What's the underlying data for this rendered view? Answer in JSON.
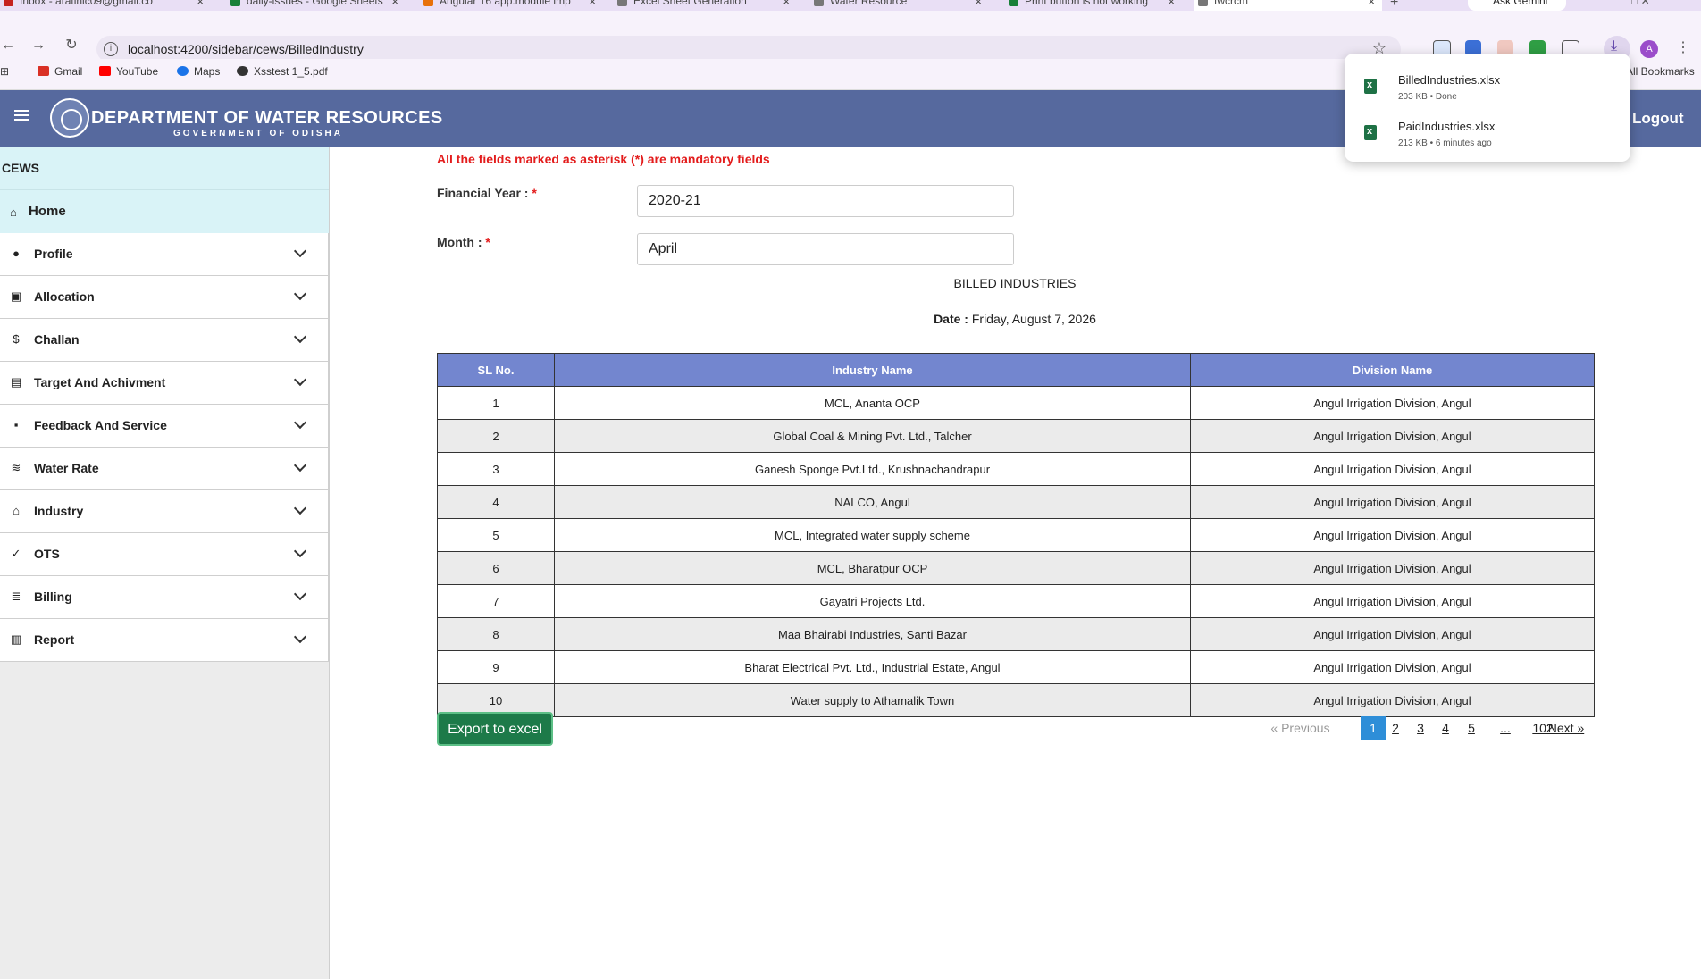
{
  "browser": {
    "tabs": [
      {
        "label": "Inbox - aratinic09@gmail.co",
        "icon_color": "#c5221f"
      },
      {
        "label": "daily-issues - Google Sheets",
        "icon_color": "#188038"
      },
      {
        "label": "Angular 16 app.module imp",
        "icon_color": "#e8710a"
      },
      {
        "label": "Excel Sheet Generation",
        "icon_color": "#777777"
      },
      {
        "label": "Water Resource",
        "icon_color": "#777777"
      },
      {
        "label": "Print button is not working",
        "icon_color": "#188038"
      },
      {
        "label": "fwcrcm",
        "icon_color": "#777777"
      }
    ],
    "ask_gemini": "Ask Gemini",
    "url": "localhost:4200/sidebar/cews/BilledIndustry",
    "bookmarks": [
      {
        "label": "Gmail",
        "icon_color": "#d93025"
      },
      {
        "label": "YouTube",
        "icon_color": "#ff0000"
      },
      {
        "label": "Maps",
        "icon_color": "#1a73e8"
      },
      {
        "label": "Xsstest 1_5.pdf",
        "icon_color": "#333333"
      }
    ],
    "all_bookmarks": "All Bookmarks",
    "profile_initial": "A"
  },
  "downloads": [
    {
      "name": "BilledIndustries.xlsx",
      "meta": "203 KB • Done"
    },
    {
      "name": "PaidIndustries.xlsx",
      "meta": "213 KB • 6 minutes ago"
    }
  ],
  "header": {
    "title": "DEPARTMENT OF WATER RESOURCES",
    "subtitle": "GOVERNMENT OF ODISHA",
    "logout": "Logout"
  },
  "sidebar": {
    "section": "CEWS",
    "home": "Home",
    "items": [
      {
        "label": "Profile",
        "icon": "account-circle-icon",
        "glyph": "●"
      },
      {
        "label": "Allocation",
        "icon": "note-edit-icon",
        "glyph": "▣"
      },
      {
        "label": "Challan",
        "icon": "currency-icon",
        "glyph": "$"
      },
      {
        "label": "Target And Achivment",
        "icon": "wallet-icon",
        "glyph": "▤"
      },
      {
        "label": "Feedback And Service",
        "icon": "feedback-icon",
        "glyph": "▪"
      },
      {
        "label": "Water Rate",
        "icon": "waves-icon",
        "glyph": "≋"
      },
      {
        "label": "Industry",
        "icon": "bank-icon",
        "glyph": "⌂"
      },
      {
        "label": "OTS",
        "icon": "check-icon",
        "glyph": "✓"
      },
      {
        "label": "Billing",
        "icon": "list-box-icon",
        "glyph": "≣"
      },
      {
        "label": "Report",
        "icon": "library-icon",
        "glyph": "▥"
      }
    ]
  },
  "form": {
    "mandatory_note": "All the fields marked as asterisk (*) are mandatory fields",
    "financial_year_label": "Financial Year : ",
    "financial_year_value": "2020-21",
    "month_label": "Month : ",
    "month_value": "April",
    "required_mark": "*"
  },
  "report": {
    "title": "BILLED INDUSTRIES",
    "date_label": "Date : ",
    "date_value": "Friday, August 7, 2026"
  },
  "table": {
    "headers": [
      "SL No.",
      "Industry Name",
      "Division Name"
    ],
    "rows": [
      [
        "1",
        "MCL, Ananta OCP",
        "Angul Irrigation Division, Angul"
      ],
      [
        "2",
        "Global Coal & Mining Pvt. Ltd., Talcher",
        "Angul Irrigation Division, Angul"
      ],
      [
        "3",
        "Ganesh Sponge Pvt.Ltd., Krushnachandrapur",
        "Angul Irrigation Division, Angul"
      ],
      [
        "4",
        "NALCO, Angul",
        "Angul Irrigation Division, Angul"
      ],
      [
        "5",
        "MCL, Integrated water supply scheme",
        "Angul Irrigation Division, Angul"
      ],
      [
        "6",
        "MCL, Bharatpur OCP",
        "Angul Irrigation Division, Angul"
      ],
      [
        "7",
        "Gayatri Projects Ltd.",
        "Angul Irrigation Division, Angul"
      ],
      [
        "8",
        "Maa Bhairabi Industries, Santi Bazar",
        "Angul Irrigation Division, Angul"
      ],
      [
        "9",
        "Bharat Electrical Pvt. Ltd., Industrial Estate, Angul",
        "Angul Irrigation Division, Angul"
      ],
      [
        "10",
        "Water supply to Athamalik Town",
        "Angul Irrigation Division, Angul"
      ]
    ]
  },
  "export_label": "Export to excel",
  "pagination": {
    "previous": "« Previous",
    "pages": [
      "1",
      "2",
      "3",
      "4",
      "5",
      "...",
      "102"
    ],
    "current": "1",
    "next": "Next »"
  }
}
